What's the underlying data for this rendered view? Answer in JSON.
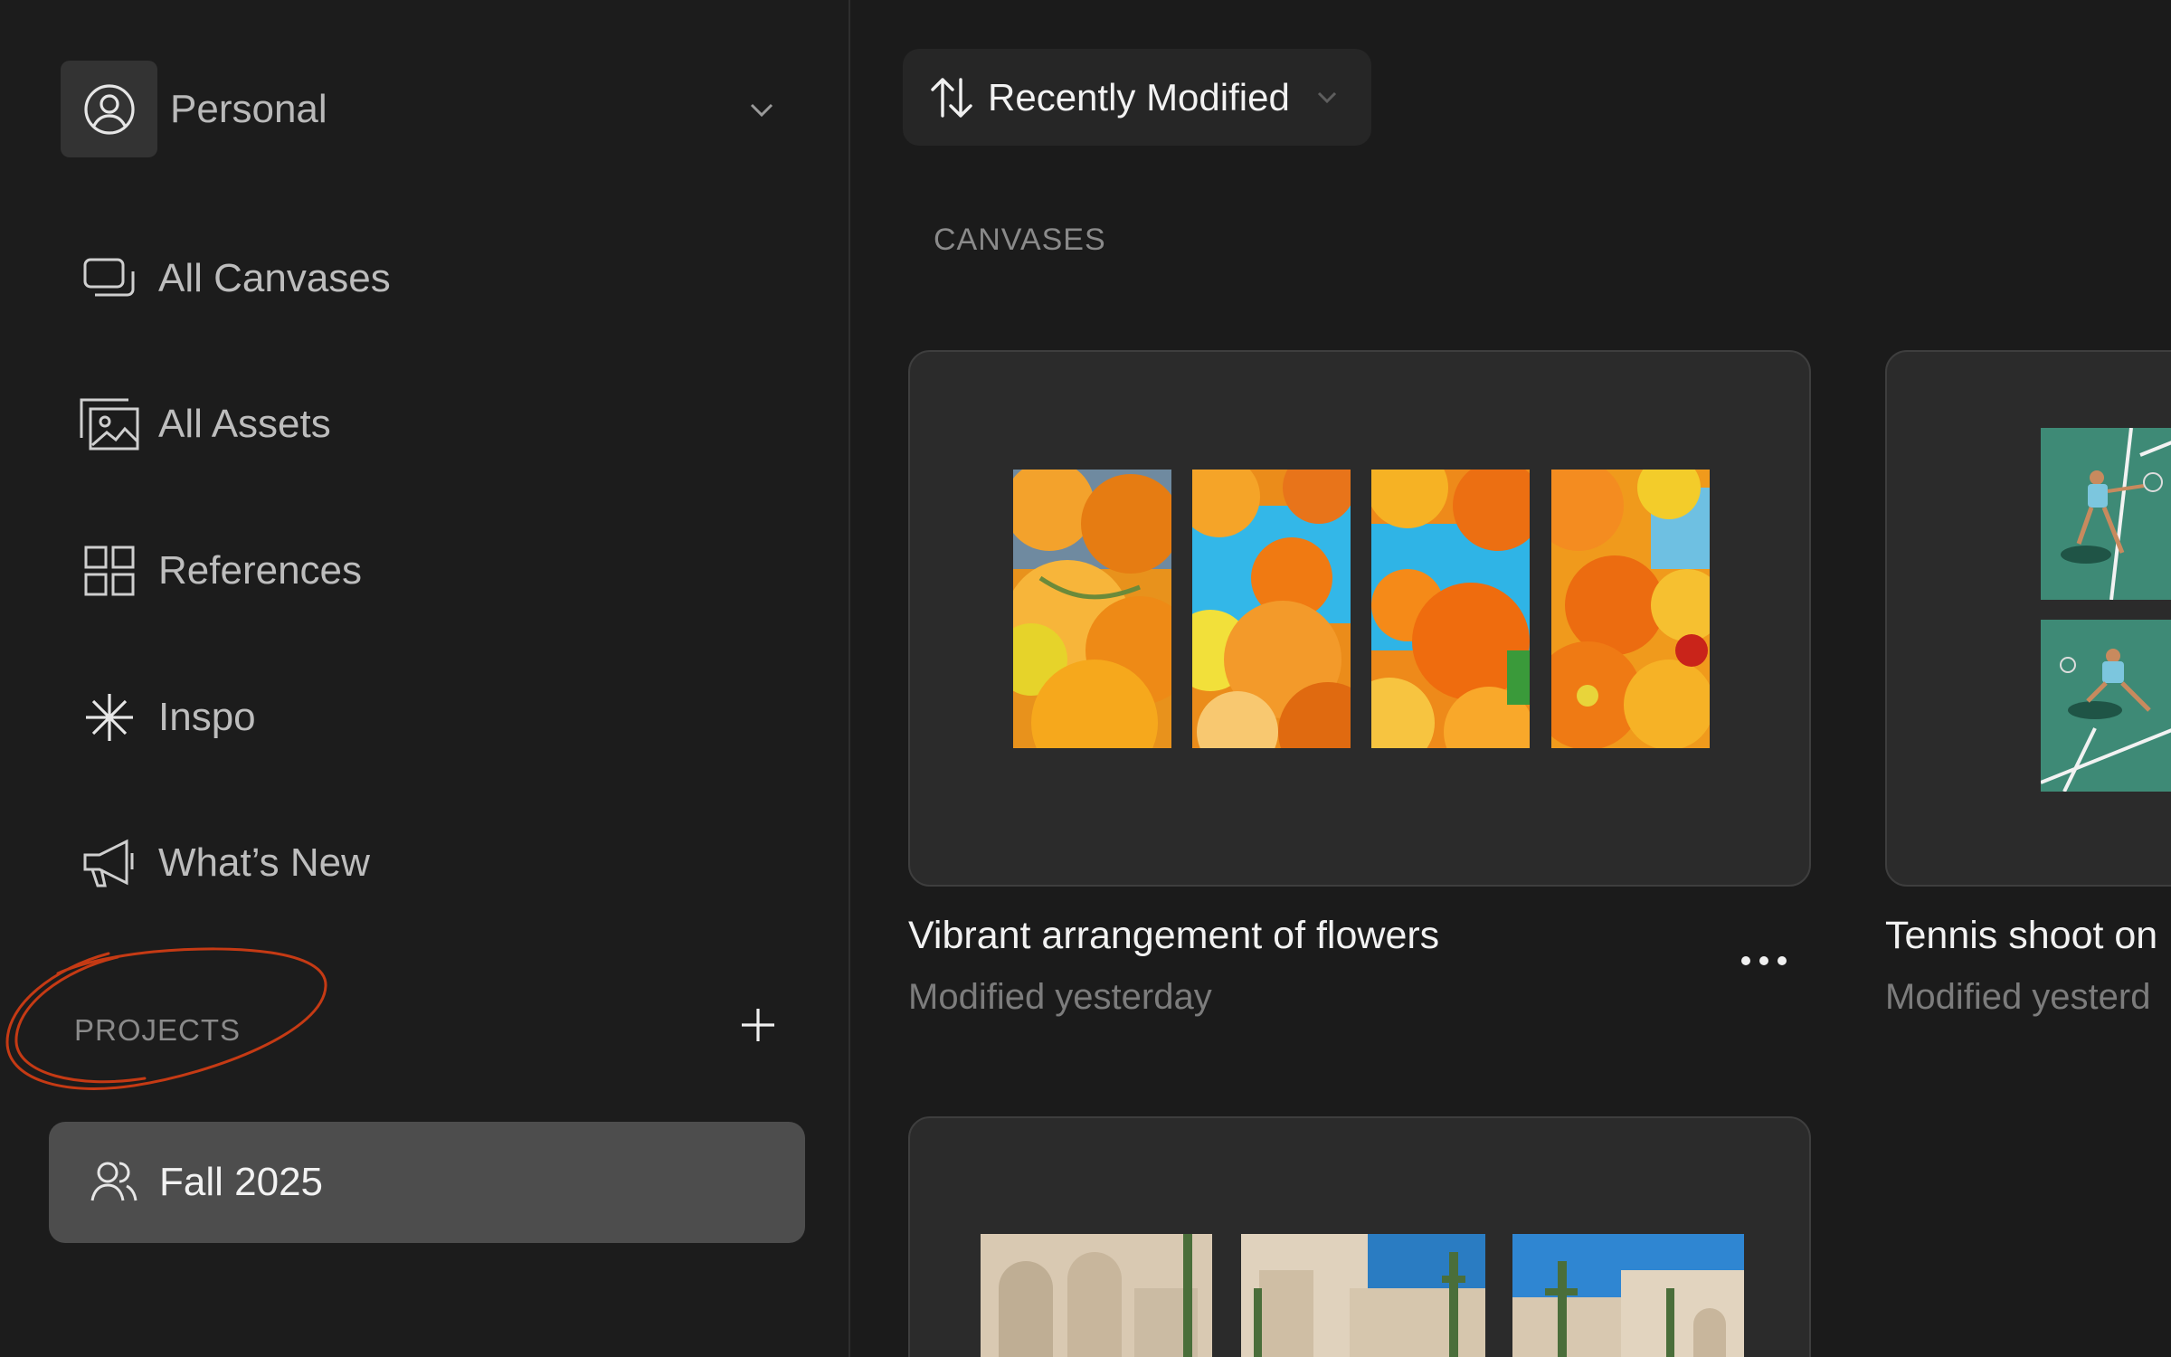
{
  "sidebar": {
    "workspace": {
      "name": "Personal"
    },
    "nav": [
      {
        "label": "All Canvases",
        "icon": "canvases-icon"
      },
      {
        "label": "All Assets",
        "icon": "assets-icon"
      },
      {
        "label": "References",
        "icon": "grid-icon"
      },
      {
        "label": "Inspo",
        "icon": "sparkle-icon"
      },
      {
        "label": "What’s New",
        "icon": "megaphone-icon"
      }
    ],
    "projects": {
      "heading": "PROJECTS",
      "items": [
        {
          "label": "Fall 2025",
          "icon": "users-icon"
        }
      ]
    }
  },
  "main": {
    "sort": {
      "label": "Recently Modified"
    },
    "section_heading": "CANVASES",
    "canvases": [
      {
        "title": "Vibrant arrangement of flowers",
        "modified": "Modified yesterday"
      },
      {
        "title": "Tennis shoot on",
        "modified": "Modified yesterd"
      },
      {
        "title": "",
        "modified": ""
      }
    ]
  },
  "colors": {
    "background": "#1b1b1b",
    "card": "#2b2b2b",
    "selected_project": "#4d4d4d",
    "annotation": "#c53a14"
  }
}
